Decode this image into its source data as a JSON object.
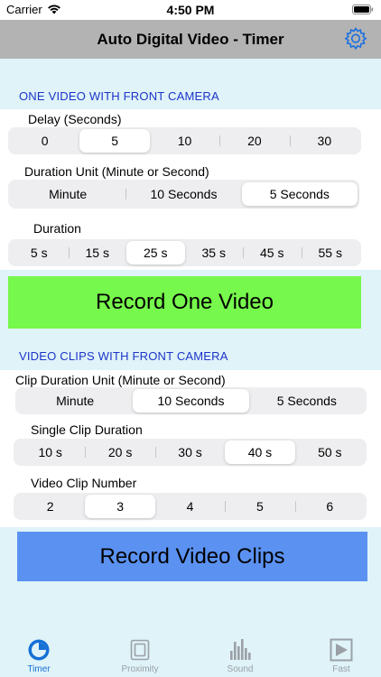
{
  "status": {
    "carrier": "Carrier",
    "time": "4:50 PM"
  },
  "nav": {
    "title": "Auto Digital Video - Timer"
  },
  "one_video": {
    "header": "ONE VIDEO WITH FRONT CAMERA",
    "delay": {
      "label": "Delay (Seconds)",
      "options": [
        "0",
        "5",
        "10",
        "20",
        "30"
      ],
      "selected": 1
    },
    "duration_unit": {
      "label": "Duration Unit (Minute or Second)",
      "options": [
        "Minute",
        "10 Seconds",
        "5 Seconds"
      ],
      "selected": 2
    },
    "duration": {
      "label": "Duration",
      "options": [
        "5 s",
        "15 s",
        "25 s",
        "35 s",
        "45 s",
        "55 s"
      ],
      "selected": 2
    },
    "record_label": "Record One Video"
  },
  "video_clips": {
    "header": "VIDEO CLIPS WITH FRONT CAMERA",
    "clip_unit": {
      "label": "Clip Duration Unit (Minute or Second)",
      "options": [
        "Minute",
        "10 Seconds",
        "5 Seconds"
      ],
      "selected": 1
    },
    "clip_duration": {
      "label": "Single Clip Duration",
      "options": [
        "10 s",
        "20 s",
        "30 s",
        "40 s",
        "50 s"
      ],
      "selected": 3
    },
    "clip_number": {
      "label": "Video Clip Number",
      "options": [
        "2",
        "3",
        "4",
        "5",
        "6"
      ],
      "selected": 1
    },
    "record_label": "Record Video Clips"
  },
  "tabs": [
    {
      "label": "Timer",
      "icon": "timer-icon",
      "active": true
    },
    {
      "label": "Proximity",
      "icon": "proximity-icon",
      "active": false
    },
    {
      "label": "Sound",
      "icon": "sound-icon",
      "active": false
    },
    {
      "label": "Fast",
      "icon": "fast-icon",
      "active": false
    }
  ],
  "colors": {
    "record_one_bg": "#77f84c",
    "record_clips_bg": "#5b92f2",
    "header_text": "#1c35c9",
    "tab_active": "#1570d6",
    "tab_inactive": "#9aa0a6"
  }
}
